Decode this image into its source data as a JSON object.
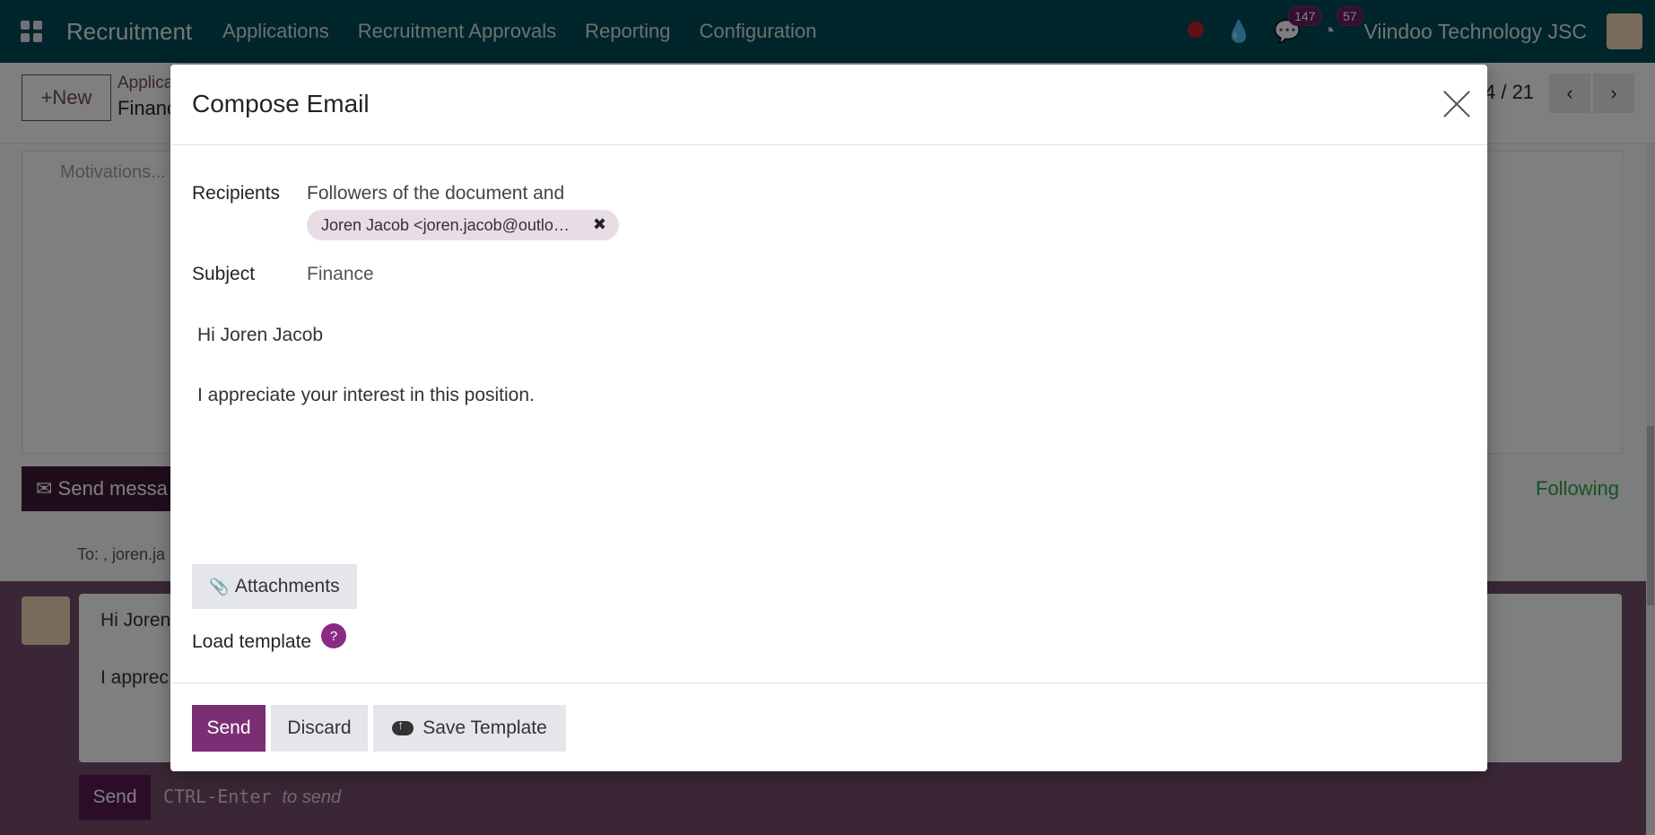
{
  "navbar": {
    "app_name": "Recruitment",
    "menu": [
      "Applications",
      "Recruitment Approvals",
      "Reporting",
      "Configuration"
    ],
    "messages_count": "147",
    "activities_count": "57",
    "company": "Viindoo Technology JSC"
  },
  "control": {
    "new_label": "New",
    "breadcrumb_parent": "Applica",
    "breadcrumb_current": "Financ",
    "pager": "4 / 21"
  },
  "background": {
    "motivations_placeholder": "Motivations...",
    "send_message_label": "Send messa",
    "following_label": "Following",
    "to_line": "To: , joren.ja",
    "composer_line1": "Hi Joren",
    "composer_line2": "I apprec",
    "composer_send": "Send",
    "ctrl_hint_key": "CTRL-Enter",
    "ctrl_hint_text": "to send"
  },
  "modal": {
    "title": "Compose Email",
    "recipients_label": "Recipients",
    "recipients_text": "Followers of the document and",
    "recipient_tag": "Joren Jacob <joren.jacob@outlo…",
    "subject_label": "Subject",
    "subject_value": "Finance",
    "body_line1": "Hi Joren Jacob",
    "body_line2": "I appreciate your interest in this position.",
    "attachments_label": "Attachments",
    "load_template_label": "Load template",
    "help_symbol": "?",
    "send_label": "Send",
    "discard_label": "Discard",
    "save_template_label": "Save Template"
  },
  "colors": {
    "navbar": "#014a55",
    "primary": "#7c2e74",
    "composer_bg": "#744d6a",
    "following": "#28a745"
  }
}
